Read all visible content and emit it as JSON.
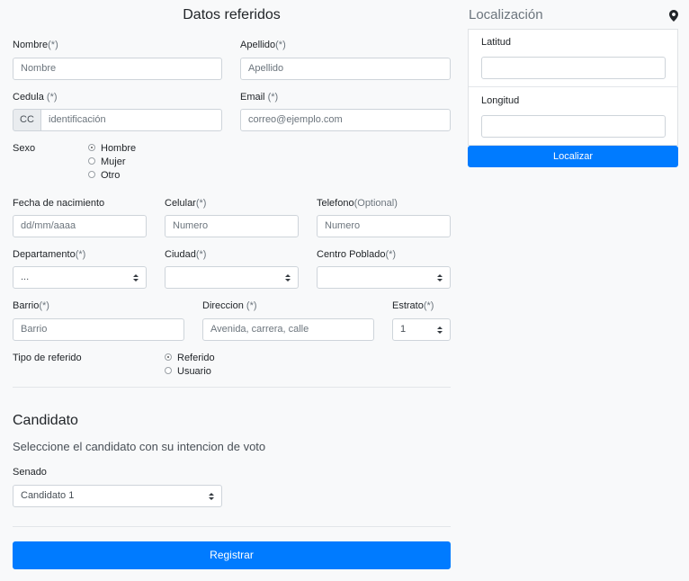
{
  "form": {
    "title": "Datos referidos",
    "nombre": {
      "label": "Nombre",
      "req": "(*)",
      "placeholder": "Nombre"
    },
    "apellido": {
      "label": "Apellido",
      "req": "(*)",
      "placeholder": "Apellido"
    },
    "cedula": {
      "label": "Cedula ",
      "req": "(*)",
      "prefix": "CC",
      "placeholder": "identificación"
    },
    "email": {
      "label": "Email ",
      "req": "(*)",
      "placeholder": "correo@ejemplo.com"
    },
    "sexo": {
      "label": "Sexo",
      "options": [
        "Hombre",
        "Mujer",
        "Otro"
      ],
      "selected": "Hombre"
    },
    "fecha": {
      "label": "Fecha de nacimiento",
      "placeholder": "dd/mm/aaaa"
    },
    "celular": {
      "label": "Celular",
      "req": "(*)",
      "placeholder": "Numero"
    },
    "telefono": {
      "label": "Telefono",
      "opt": "(Optional)",
      "placeholder": "Numero"
    },
    "departamento": {
      "label": "Departamento",
      "req": "(*)",
      "value": "..."
    },
    "ciudad": {
      "label": "Ciudad",
      "req": "(*)",
      "value": ""
    },
    "centro": {
      "label": "Centro Poblado",
      "req": "(*)",
      "value": ""
    },
    "barrio": {
      "label": "Barrio",
      "req": "(*)",
      "placeholder": "Barrio"
    },
    "direccion": {
      "label": "Direccion ",
      "req": "(*)",
      "placeholder": "Avenida, carrera, calle"
    },
    "estrato": {
      "label": "Estrato",
      "req": "(*)",
      "value": "1"
    },
    "tipo": {
      "label": "Tipo de referido",
      "options": [
        "Referido",
        "Usuario"
      ],
      "selected": "Referido"
    }
  },
  "candidato": {
    "title": "Candidato",
    "subtitle": "Seleccione el candidato con su intencion de voto",
    "senado_label": "Senado",
    "senado_value": "Candidato 1"
  },
  "submit_label": "Registrar",
  "localizacion": {
    "title": "Localización",
    "latitud_label": "Latitud",
    "latitud_value": "",
    "longitud_label": "Longitud",
    "longitud_value": "",
    "button_label": "Localizar"
  },
  "colors": {
    "primary": "#007bff",
    "background": "#f8f9fa"
  },
  "icons": {
    "location": "map-marker-icon",
    "select": "select-arrows-icon"
  }
}
